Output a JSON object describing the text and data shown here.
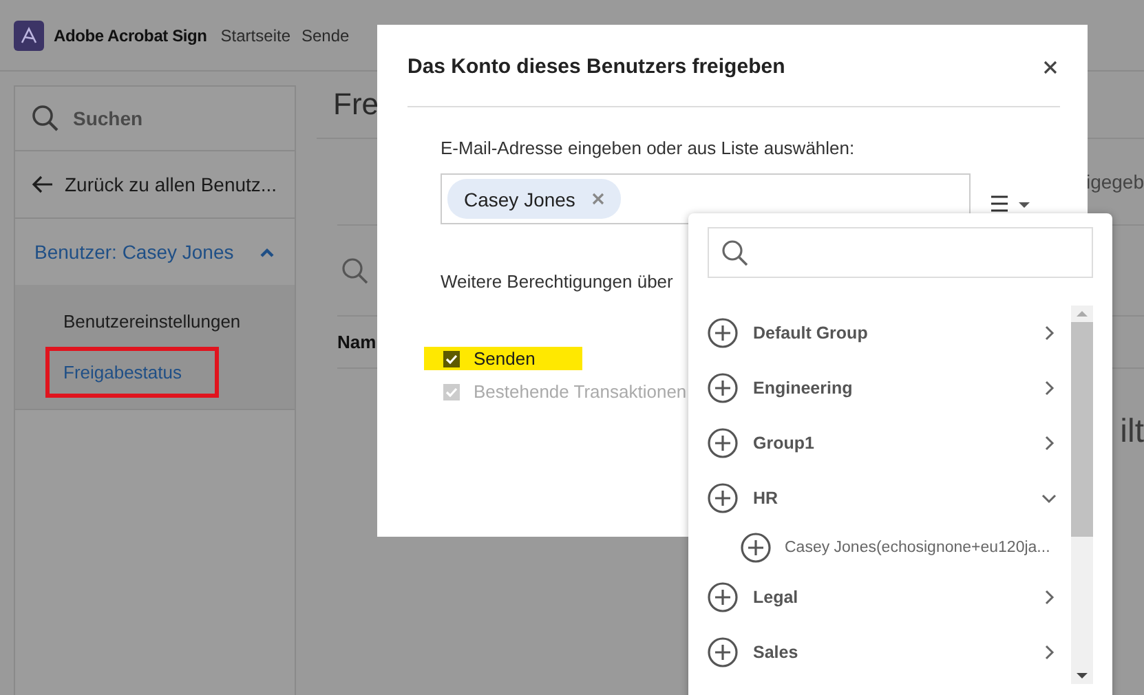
{
  "app": {
    "name": "Adobe Acrobat Sign",
    "nav": [
      {
        "label": "Startseite"
      },
      {
        "label": "Sende"
      }
    ]
  },
  "sidebar": {
    "search": {
      "placeholder": "Suchen"
    },
    "back": "Zurück zu allen Benutz...",
    "user": {
      "label": "Benutzer: Casey Jones",
      "expanded": true
    },
    "items": [
      {
        "label": "Benutzereinstellungen",
        "selected": false,
        "highlighted": false
      },
      {
        "label": "Freigabestatus",
        "selected": true,
        "highlighted": true
      }
    ]
  },
  "main": {
    "heading": "Fre",
    "column_1": "Nam",
    "fragment_1": "igegeb",
    "fragment_2": "ilt"
  },
  "dialog": {
    "title": "Das Konto dieses Benutzers freigeben",
    "email_label": "E-Mail-Adresse eingeben oder aus Liste auswählen:",
    "recipients": [
      {
        "name": "Casey Jones"
      }
    ],
    "permissions_label": "Weitere Berechtigungen über",
    "permissions": [
      {
        "label": "Senden",
        "checked": true,
        "disabled": false,
        "highlighted": true
      },
      {
        "label": "Bestehende Transaktionen",
        "checked": true,
        "disabled": true,
        "highlighted": false
      }
    ]
  },
  "dropdown": {
    "groups": [
      {
        "label": "Default Group",
        "expanded": false
      },
      {
        "label": "Engineering",
        "expanded": false
      },
      {
        "label": "Group1",
        "expanded": false
      },
      {
        "label": "HR",
        "expanded": true,
        "children": [
          {
            "label": "Casey Jones(echosignone+eu120ja..."
          }
        ]
      },
      {
        "label": "Legal",
        "expanded": false
      },
      {
        "label": "Sales",
        "expanded": false
      }
    ]
  }
}
